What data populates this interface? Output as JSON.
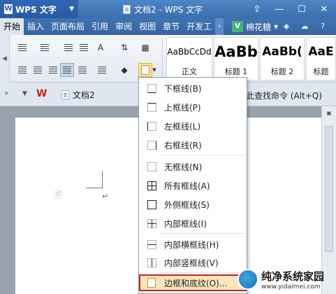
{
  "app": {
    "name": "WPS 文字",
    "window_title": "文档2 - WPS 文字"
  },
  "menu": {
    "tabs": [
      "开始",
      "插入",
      "页面布局",
      "引用",
      "审阅",
      "视图",
      "章节",
      "开发工"
    ],
    "user_name": "棉花糖",
    "user_initial": "V"
  },
  "ribbon": {
    "styles": [
      {
        "preview": "AaBbCcDd",
        "name": "正文"
      },
      {
        "preview": "AaBb",
        "name": "标题 1"
      },
      {
        "preview": "AaBb(",
        "name": "标题 2"
      },
      {
        "preview": "AaE",
        "name": "标题"
      }
    ]
  },
  "tabbar": {
    "document_tab": "文档2",
    "search_command": "点此查找命令 (Alt+Q)"
  },
  "border_menu": {
    "items": [
      {
        "label": "下框线(B)",
        "icon": "bottom-border-icon"
      },
      {
        "label": "上框线(P)",
        "icon": "top-border-icon"
      },
      {
        "label": "左框线(L)",
        "icon": "left-border-icon"
      },
      {
        "label": "右框线(R)",
        "icon": "right-border-icon"
      },
      {
        "label": "无框线(N)",
        "icon": "no-border-icon"
      },
      {
        "label": "所有框线(A)",
        "icon": "all-borders-icon"
      },
      {
        "label": "外侧框线(S)",
        "icon": "outside-borders-icon"
      },
      {
        "label": "内部框线(I)",
        "icon": "inside-borders-icon"
      },
      {
        "label": "内部横框线(H)",
        "icon": "inside-horizontal-border-icon"
      },
      {
        "label": "内部竖框线(V)",
        "icon": "inside-vertical-border-icon"
      },
      {
        "label": "边框和底纹(O)...",
        "icon": "borders-and-shading-icon"
      }
    ]
  },
  "watermark": {
    "title": "纯净系统家园",
    "url": "www.yidaimei.com"
  },
  "colors": {
    "title_bar": "#3c6fae",
    "selection_outline": "#c8221e",
    "selection_fill": "#fbe5bc"
  }
}
